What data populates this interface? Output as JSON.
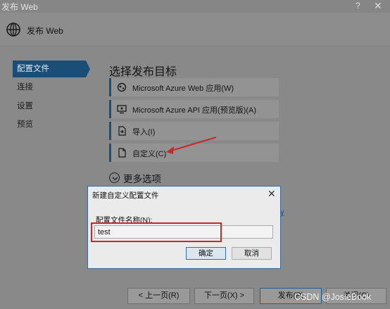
{
  "window": {
    "title": "发布 Web",
    "help": "?",
    "close": "✕"
  },
  "header": {
    "title": "发布 Web",
    "icon": "globe-icon"
  },
  "sidebar": {
    "items": [
      {
        "label": "配置文件",
        "active": true
      },
      {
        "label": "连接"
      },
      {
        "label": "设置"
      },
      {
        "label": "预览"
      }
    ]
  },
  "main": {
    "title": "选择发布目标",
    "targets": [
      {
        "label": "Microsoft Azure Web 应用(W)",
        "icon": "azure-web-icon"
      },
      {
        "label": "Microsoft Azure API 应用(预览版)(A)",
        "icon": "azure-api-icon"
      },
      {
        "label": "导入(I)",
        "icon": "import-icon"
      },
      {
        "label": "自定义(C)",
        "icon": "document-icon"
      }
    ],
    "more_options": "更多选项",
    "link_fragment": "y"
  },
  "dialog": {
    "title": "新建自定义配置文件",
    "close": "✕",
    "field_label": "配置文件名称(N):",
    "field_value": "test",
    "ok_label": "确定",
    "cancel_label": "取消"
  },
  "footer": {
    "prev_label": "< 上一页(R)",
    "next_label": "下一页(X) >",
    "publish_label": "发布(P)",
    "close_label": "关闭(C)"
  },
  "watermark": "CSDN @JosieBook",
  "colors": {
    "accent": "#1b4e76",
    "highlight": "#c8282a"
  }
}
